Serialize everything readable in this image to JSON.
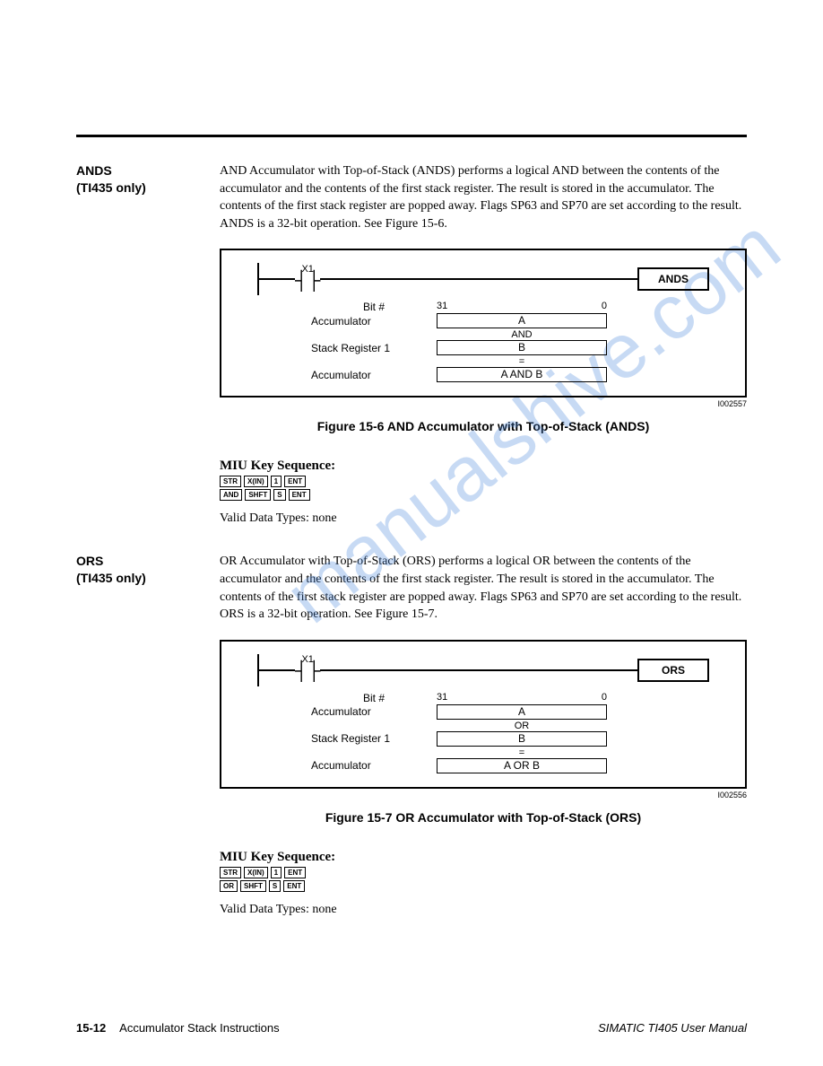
{
  "watermark": "manualshive.com",
  "ands": {
    "heading": "ANDS",
    "sub": "(TI435 only)",
    "desc": "AND Accumulator with Top-of-Stack (ANDS) performs a logical AND between the contents of the accumulator and the contents of the first stack register. The result is stored in the accumulator. The contents of the first stack register are popped away. Flags SP63 and SP70 are set according to the result. ANDS is a 32-bit operation. See Figure 15-6.",
    "fig": {
      "contact": "X1",
      "fname": "ANDS",
      "bitlabel": "Bit #",
      "bithi": "31",
      "bitlo": "0",
      "r1l": "Accumulator",
      "r1v": "A",
      "op1": "AND",
      "r2l": "Stack Register 1",
      "r2v": "B",
      "op2": "=",
      "r3l": "Accumulator",
      "r3v": "A AND B",
      "id": "I002557",
      "caption": "Figure 15-6   AND Accumulator with Top-of-Stack (ANDS)"
    },
    "miu_title": "MIU Key Sequence:",
    "keys1": [
      "STR",
      "X(IN)",
      "1",
      "ENT"
    ],
    "keys2": [
      "AND",
      "SHFT",
      "S",
      "ENT"
    ],
    "valid": "Valid Data Types:  none"
  },
  "ors": {
    "heading": "ORS",
    "sub": "(TI435 only)",
    "desc": "OR Accumulator with Top-of-Stack (ORS) performs a logical OR between the contents of the accumulator and the contents of the first stack register. The result is stored in the accumulator. The contents of the first stack register are popped away. Flags SP63 and SP70 are set according to the result. ORS is a 32-bit operation. See Figure 15-7.",
    "fig": {
      "contact": "X1",
      "fname": "ORS",
      "bitlabel": "Bit #",
      "bithi": "31",
      "bitlo": "0",
      "r1l": "Accumulator",
      "r1v": "A",
      "op1": "OR",
      "r2l": "Stack Register 1",
      "r2v": "B",
      "op2": "=",
      "r3l": "Accumulator",
      "r3v": "A OR B",
      "id": "I002556",
      "caption": "Figure 15-7   OR Accumulator with Top-of-Stack (ORS)"
    },
    "miu_title": "MIU Key Sequence:",
    "keys1": [
      "STR",
      "X(IN)",
      "1",
      "ENT"
    ],
    "keys2": [
      "OR",
      "SHFT",
      "S",
      "ENT"
    ],
    "valid": "Valid Data Types:  none"
  },
  "footer": {
    "page": "15-12",
    "left": "Accumulator Stack Instructions",
    "right": "SIMATIC TI405 User Manual"
  }
}
